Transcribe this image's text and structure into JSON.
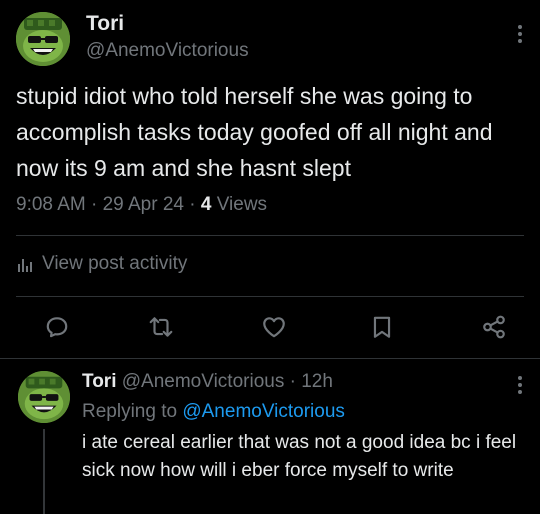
{
  "main_post": {
    "author": {
      "display_name": "Tori",
      "handle": "@AnemoVictorious"
    },
    "text": "stupid idiot who told herself she was going to accomplish tasks today goofed off all night and now its 9 am and she hasnt slept",
    "time": "9:08 AM",
    "sep1": " · ",
    "date": "29 Apr 24",
    "sep2": " · ",
    "views_count": "4",
    "views_label": " Views",
    "activity_label": "View post activity"
  },
  "actions": {
    "icons": [
      "reply-icon",
      "repost-icon",
      "like-icon",
      "bookmark-icon",
      "share-icon"
    ]
  },
  "reply": {
    "display_name": "Tori",
    "handle": "@AnemoVictorious",
    "sep": " · ",
    "time_ago": "12h",
    "replying_prefix": "Replying to ",
    "replying_to": "@AnemoVictorious",
    "text": "i ate cereal earlier that was not a good idea bc i feel sick now how will i eber force myself to write"
  },
  "colors": {
    "background": "#000000",
    "text_primary": "#e7e9ea",
    "text_secondary": "#71767b",
    "accent": "#1d9bf0",
    "divider": "#2f3336",
    "avatar_green": "#6a9a3a"
  }
}
